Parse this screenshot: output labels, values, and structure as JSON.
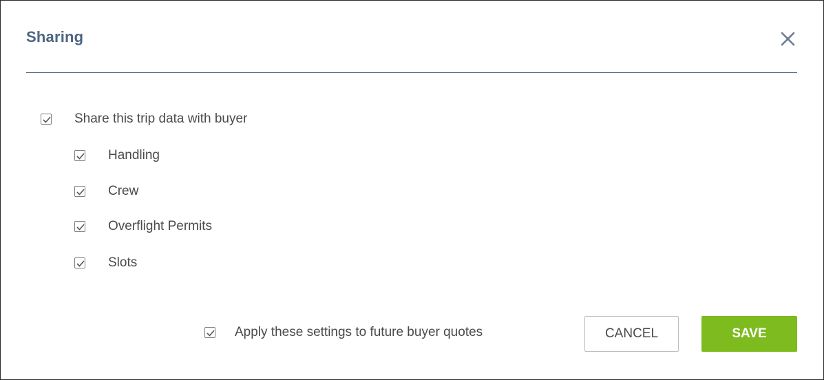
{
  "dialog": {
    "title": "Sharing",
    "close_icon": "close-icon"
  },
  "share_main": {
    "label": "Share this trip data with buyer",
    "checked": true
  },
  "share_items": [
    {
      "label": "Handling",
      "checked": true
    },
    {
      "label": "Crew",
      "checked": true
    },
    {
      "label": "Overflight Permits",
      "checked": true
    },
    {
      "label": "Slots",
      "checked": true
    }
  ],
  "footer": {
    "apply_label": "Apply these settings to future buyer quotes",
    "apply_checked": true,
    "cancel_label": "CANCEL",
    "save_label": "SAVE"
  },
  "colors": {
    "title": "#4e6584",
    "save_bg": "#7dbb1e",
    "text": "#4a4a4a"
  }
}
